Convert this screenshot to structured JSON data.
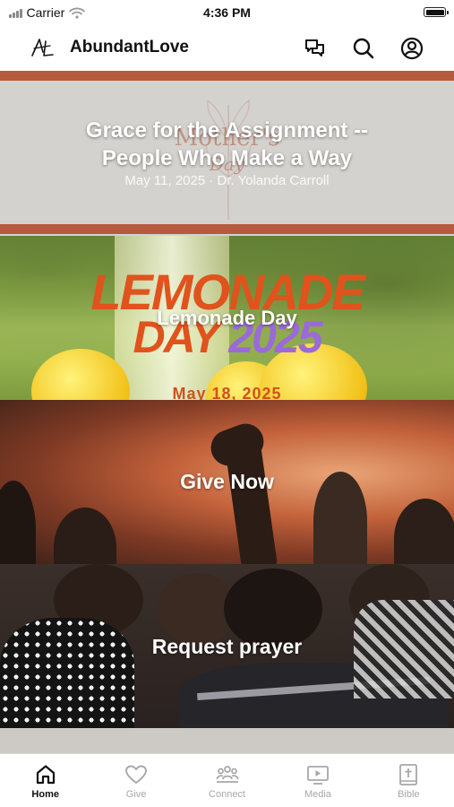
{
  "status_bar": {
    "carrier": "Carrier",
    "time": "4:36 PM"
  },
  "header": {
    "logo_text": "AL",
    "title": "AbundantLove"
  },
  "cards": [
    {
      "title_line1": "Grace for the Assignment --",
      "title_line2": "People Who Make a Way",
      "subtitle": "May 11, 2025 · Dr. Yolanda Carroll",
      "bg_text_line1": "Mother's",
      "bg_text_line2": "Day"
    },
    {
      "title": "Lemonade Day",
      "bg_text_line1": "LEMONADE",
      "bg_text_line2": "DAY",
      "bg_text_year": "2025",
      "bg_date": "May 18, 2025"
    },
    {
      "title": "Give Now"
    },
    {
      "title": "Request prayer"
    }
  ],
  "tabs": [
    {
      "label": "Home",
      "icon": "home-icon",
      "active": true
    },
    {
      "label": "Give",
      "icon": "heart-icon",
      "active": false
    },
    {
      "label": "Connect",
      "icon": "people-icon",
      "active": false
    },
    {
      "label": "Media",
      "icon": "play-icon",
      "active": false
    },
    {
      "label": "Bible",
      "icon": "bible-icon",
      "active": false
    }
  ],
  "colors": {
    "accent_band": "#b65a3e",
    "active_tab": "#111111",
    "inactive_tab": "#a7a7a7",
    "lemonade_orange": "#e0531c",
    "lemonade_purple": "#9b6ad8"
  }
}
